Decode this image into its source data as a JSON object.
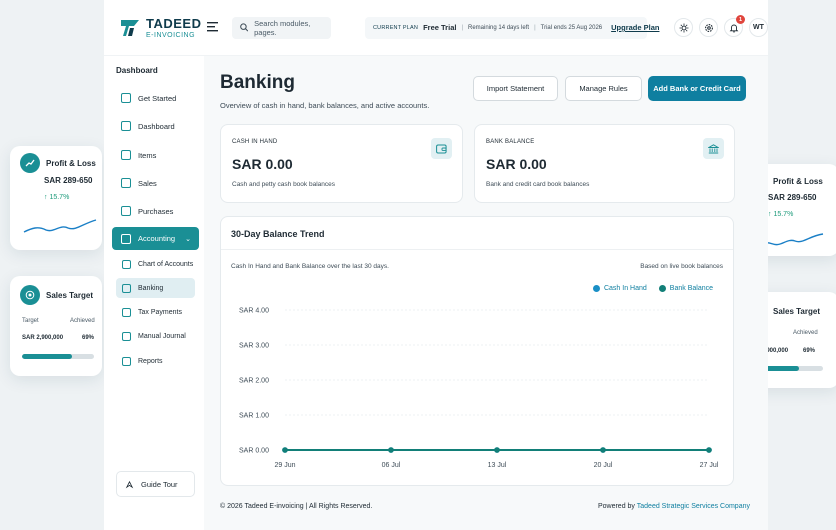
{
  "app": {
    "logo_main": "TADEED",
    "logo_sub": "E-INVOICING",
    "search_placeholder": "Search modules, pages.",
    "plan": {
      "label": "CURRENT PLAN",
      "name": "Free Trial",
      "remaining": "Remaining 14 days left",
      "ends": "Trial ends 25 Aug 2026",
      "upgrade": "Upgrade Plan"
    },
    "notifications_count": "1",
    "user_initials": "WT"
  },
  "sidebar": {
    "heading": "Dashboard",
    "items": [
      {
        "label": "Get Started"
      },
      {
        "label": "Dashboard"
      },
      {
        "label": "Items"
      },
      {
        "label": "Sales"
      },
      {
        "label": "Purchases"
      },
      {
        "label": "Accounting"
      }
    ],
    "subitems": [
      {
        "label": "Chart of Accounts"
      },
      {
        "label": "Banking"
      },
      {
        "label": "Tax Payments"
      },
      {
        "label": "Manual Journal"
      },
      {
        "label": "Reports"
      }
    ],
    "guide_tour": "Guide Tour"
  },
  "page": {
    "title": "Banking",
    "subtitle": "Overview of cash in hand, bank balances, and active accounts.",
    "buttons": {
      "import": "Import Statement",
      "rules": "Manage Rules",
      "add": "Add Bank or Credit Card"
    },
    "cash": {
      "label": "CASH IN HAND",
      "value": "SAR 0.00",
      "desc": "Cash and petty cash book balances"
    },
    "bank": {
      "label": "BANK BALANCE",
      "value": "SAR 0.00",
      "desc": "Bank and credit card book balances"
    },
    "chart": {
      "title": "30-Day Balance Trend",
      "subtitle": "Cash In Hand and Bank Balance over the last 30 days.",
      "note": "Based on live book balances"
    }
  },
  "chart_data": {
    "type": "line",
    "x": [
      "29 Jun",
      "06 Jul",
      "13 Jul",
      "20 Jul",
      "27 Jul"
    ],
    "y_ticks": [
      "SAR 0.00",
      "SAR 1.00",
      "SAR 2.00",
      "SAR 3.00",
      "SAR 4.00"
    ],
    "ylim": [
      0,
      4
    ],
    "grid": true,
    "legend_position": "top-right",
    "series": [
      {
        "name": "Cash In Hand",
        "color": "#1a8fc6",
        "values": [
          0,
          0,
          0,
          0,
          0
        ]
      },
      {
        "name": "Bank Balance",
        "color": "#127f78",
        "values": [
          0,
          0,
          0,
          0,
          0
        ]
      }
    ]
  },
  "floating": {
    "pl_title": "Profit & Loss",
    "pl_value": "SAR 289-650",
    "pl_delta": "↑ 15.7%",
    "pl_right_value": "SAR 289-650",
    "pl_right_delta": "15.7%",
    "st_title": "Sales Target",
    "st_target_label": "Target",
    "st_achieved_label": "Achieved",
    "st_target": "SAR 2,900,000",
    "st_percent": "69%",
    "st_progress": 0.69
  },
  "footer": {
    "copyright": "© 2026 Tadeed E-invoicing | All Rights Reserved.",
    "powered": "Powered by",
    "company": "Tadeed Strategic Services Company"
  }
}
